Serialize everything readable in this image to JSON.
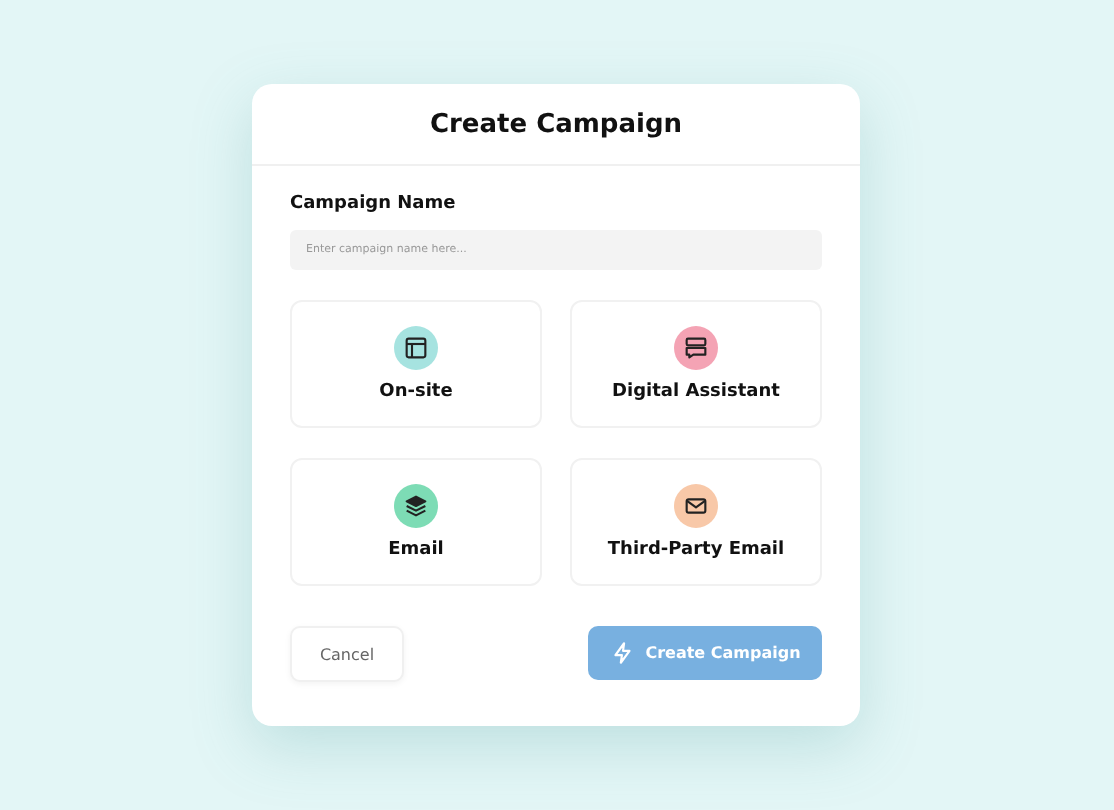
{
  "dialog": {
    "title": "Create Campaign"
  },
  "name_field": {
    "label": "Campaign Name",
    "placeholder": "Enter campaign name here..."
  },
  "options": [
    {
      "label": "On-site",
      "kind": "layout",
      "color": "#a6e3e0",
      "selected": false
    },
    {
      "label": "Digital Assistant",
      "kind": "chat",
      "color": "#f4a3b4",
      "selected": false
    },
    {
      "label": "Email",
      "kind": "stack",
      "color": "#7ddcb5",
      "selected": false
    },
    {
      "label": "Third-Party Email",
      "kind": "envelope",
      "color": "#f8c8a8",
      "selected": false
    }
  ],
  "buttons": {
    "cancel": "Cancel",
    "create": {
      "label": "Create Campaign",
      "disabled": true
    }
  }
}
